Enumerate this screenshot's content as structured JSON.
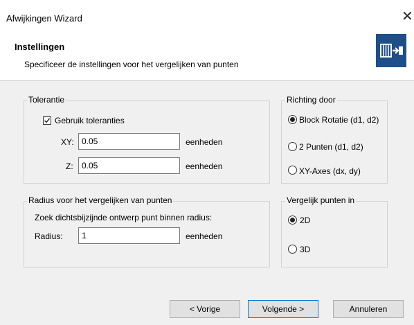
{
  "window": {
    "title": "Afwijkingen Wizard",
    "close_glyph": "✕"
  },
  "header": {
    "title": "Instellingen",
    "subtitle": "Specificeer de instellingen voor het vergelijken van punten",
    "logo_icon": "wizard-logo-icon"
  },
  "tolerance": {
    "legend": "Tolerantie",
    "checkbox_label": "Gebruik toleranties",
    "checked": true,
    "xy_label": "XY:",
    "xy_value": "0.05",
    "xy_unit": "eenheden",
    "z_label": "Z:",
    "z_value": "0.05",
    "z_unit": "eenheden"
  },
  "direction": {
    "legend": "Richting door",
    "options": [
      "Block Rotatie (d1, d2)",
      "2 Punten (d1, d2)",
      "XY-Axes (dx, dy)"
    ],
    "selected": 0
  },
  "radius": {
    "legend": "Radius voor het vergelijken van punten",
    "description": "Zoek dichtsbijzijnde ontwerp punt binnen radius:",
    "label": "Radius:",
    "value": "1",
    "unit": "eenheden"
  },
  "compare": {
    "legend": "Vergelijk punten in",
    "options": [
      "2D",
      "3D"
    ],
    "selected": 0
  },
  "buttons": {
    "prev": "< Vorige",
    "next": "Volgende >",
    "cancel": "Annuleren"
  }
}
